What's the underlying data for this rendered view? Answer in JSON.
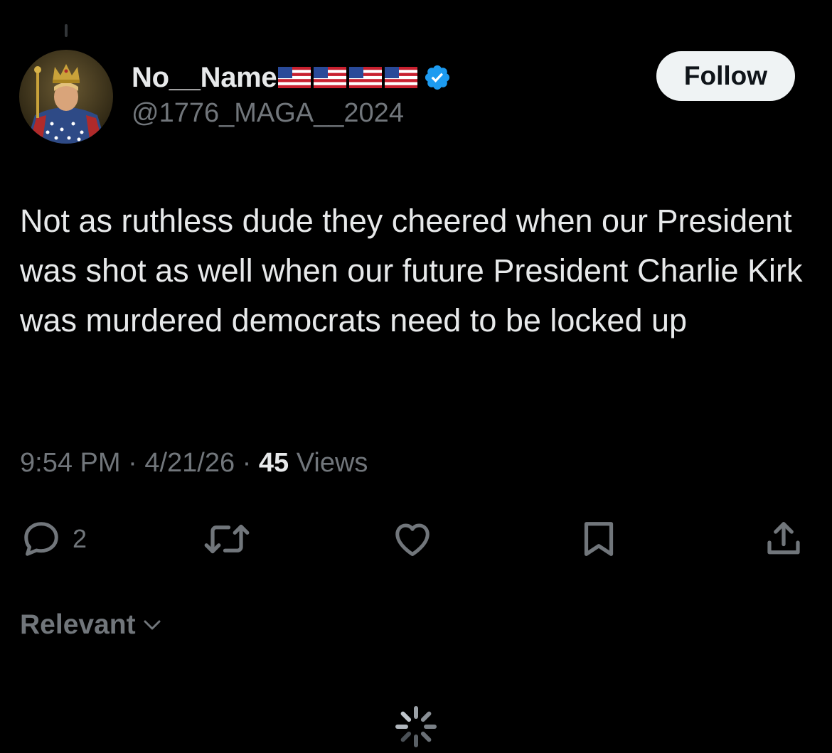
{
  "post": {
    "author": {
      "display_name": "No__Name",
      "handle": "@1776_MAGA__2024",
      "flag_emoji_count": 4,
      "verified": true
    },
    "follow_label": "Follow",
    "text": "Not as ruthless dude they cheered when our President was shot as well when our future President Charlie Kirk was murdered democrats need to be locked up",
    "time": "9:54 PM",
    "separator": " · ",
    "date": "4/21/26",
    "views_count": "45",
    "views_label": " Views"
  },
  "actions": {
    "reply_count": "2",
    "icons": [
      "reply-icon",
      "repost-icon",
      "like-icon",
      "bookmark-icon",
      "share-icon"
    ]
  },
  "sort": {
    "label": "Relevant"
  },
  "colors": {
    "background": "#000000",
    "primary_text": "#e7e9ea",
    "secondary_text": "#71767b",
    "verified_blue": "#1d9bf0",
    "follow_button_bg": "#eff3f4"
  }
}
